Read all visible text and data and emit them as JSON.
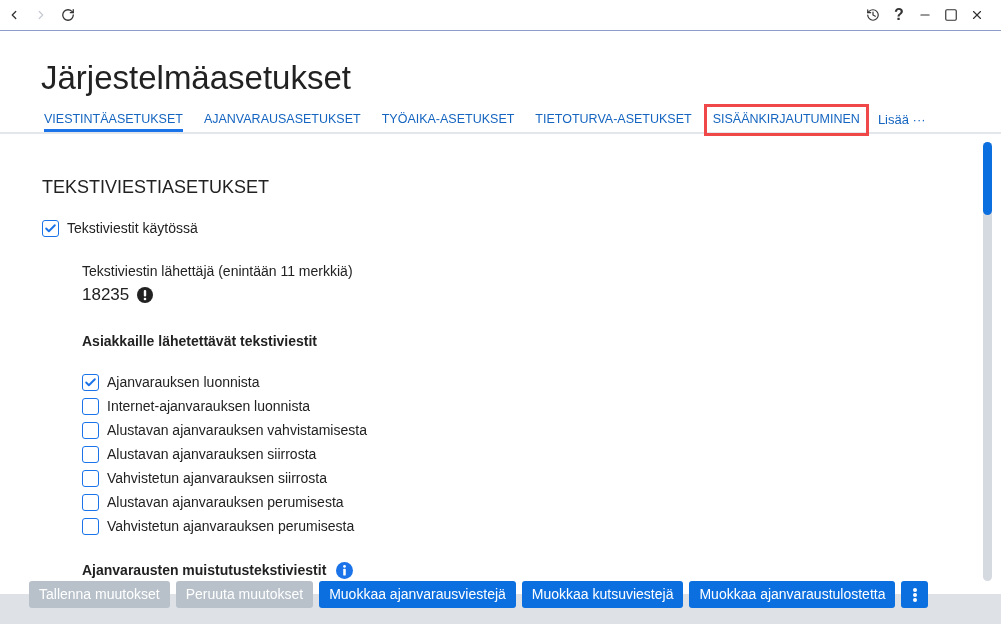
{
  "toolbar": {
    "nav": [
      {
        "kind": "back",
        "disabled": false
      },
      {
        "kind": "forward",
        "disabled": true
      },
      {
        "kind": "reload",
        "disabled": false
      }
    ],
    "window_controls": [
      {
        "kind": "history"
      },
      {
        "kind": "help",
        "label": "?"
      },
      {
        "kind": "minimize"
      },
      {
        "kind": "maximize"
      },
      {
        "kind": "close"
      }
    ]
  },
  "page": {
    "title": "Järjestelmäasetukset"
  },
  "tabs": [
    {
      "label": "VIESTINTÄASETUKSET",
      "selected": true,
      "highlighted": false
    },
    {
      "label": "AJANVARAUSASETUKSET",
      "selected": false,
      "highlighted": false
    },
    {
      "label": "TYÖAIKA-ASETUKSET",
      "selected": false,
      "highlighted": false
    },
    {
      "label": "TIETOTURVA-ASETUKSET",
      "selected": false,
      "highlighted": false
    },
    {
      "label": "SISÄÄNKIRJAUTUMINEN",
      "selected": false,
      "highlighted": true
    }
  ],
  "more_tab": {
    "label": "Lisää ···"
  },
  "sms_settings": {
    "heading": "TEKSTIVIESTIASETUKSET",
    "enabled": {
      "label": "Tekstiviestit käytössä",
      "checked": true
    },
    "sender": {
      "label": "Tekstiviestin lähettäjä (enintään 11 merkkiä)",
      "value": "18235",
      "warning": true
    },
    "customer_messages": {
      "heading": "Asiakkaille lähetettävät tekstiviestit",
      "options": [
        {
          "label": "Ajanvarauksen luonnista",
          "checked": true
        },
        {
          "label": "Internet-ajanvarauksen luonnista",
          "checked": false
        },
        {
          "label": "Alustavan ajanvarauksen vahvistamisesta",
          "checked": false
        },
        {
          "label": "Alustavan ajanvarauksen siirrosta",
          "checked": false
        },
        {
          "label": "Vahvistetun ajanvarauksen siirrosta",
          "checked": false
        },
        {
          "label": "Alustavan ajanvarauksen perumisesta",
          "checked": false
        },
        {
          "label": "Vahvistetun ajanvarauksen perumisesta",
          "checked": false
        }
      ]
    },
    "reminders": {
      "heading": "Ajanvarausten muistutustekstiviestit",
      "info": true
    }
  },
  "footer": {
    "buttons": [
      {
        "kind": "text",
        "label": "Tallenna muutokset",
        "disabled": true
      },
      {
        "kind": "text",
        "label": "Peruuta muutokset",
        "disabled": true
      },
      {
        "kind": "text",
        "label": "Muokkaa ajanvarausviestejä",
        "disabled": false
      },
      {
        "kind": "text",
        "label": "Muokkaa kutsuviestejä",
        "disabled": false
      },
      {
        "kind": "text",
        "label": "Muokkaa ajanvaraustulostetta",
        "disabled": false
      },
      {
        "kind": "menu",
        "disabled": false
      }
    ]
  }
}
